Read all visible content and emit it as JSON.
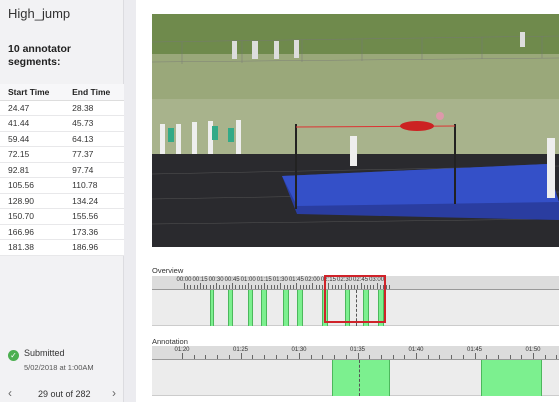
{
  "sidebar": {
    "title": "High_jump",
    "segments_heading": "10 annotator segments:",
    "columns": [
      "Start Time",
      "End Time"
    ],
    "rows": [
      [
        "24.47",
        "28.38"
      ],
      [
        "41.44",
        "45.73"
      ],
      [
        "59.44",
        "64.13"
      ],
      [
        "72.15",
        "77.37"
      ],
      [
        "92.81",
        "97.74"
      ],
      [
        "105.56",
        "110.78"
      ],
      [
        "128.90",
        "134.24"
      ],
      [
        "150.70",
        "155.56"
      ],
      [
        "166.96",
        "173.36"
      ],
      [
        "181.38",
        "186.96"
      ]
    ],
    "status": "Submitted",
    "status_date": "5/02/2018 at 1:00AM",
    "pager": {
      "prev_icon": "‹",
      "count": "29 out of 282",
      "next_icon": "›"
    }
  },
  "overview": {
    "label": "Overview",
    "ticks": [
      "00:00",
      "00:15",
      "00:30",
      "00:45",
      "01:00",
      "01:15",
      "01:30",
      "01:45",
      "02:00",
      "02:15",
      "02:30",
      "02:45",
      "03:00"
    ]
  },
  "annotation": {
    "label": "Annotation",
    "ticks": [
      "01:20",
      "01:25",
      "01:30",
      "01:35",
      "01:40",
      "01:45",
      "01:50"
    ]
  },
  "colors": {
    "segment": "#7cf08f",
    "viewport": "#d0232a",
    "submitted": "#4caf50"
  }
}
